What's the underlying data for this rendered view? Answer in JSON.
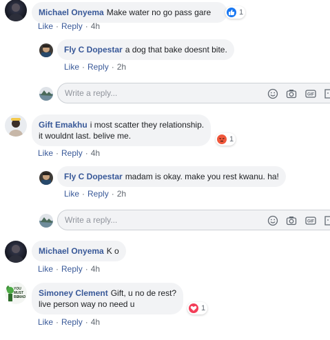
{
  "comments": [
    {
      "author": "Michael Onyema",
      "text": [
        "Make water no go pass gare"
      ],
      "reaction": {
        "type": "like",
        "count": "1"
      },
      "actions": {
        "like": "Like",
        "reply": "Reply",
        "time": "4h"
      }
    },
    {
      "author": "Fly C Dopestar",
      "text": [
        "a dog that bake doesnt bite."
      ],
      "actions": {
        "like": "Like",
        "reply": "Reply",
        "time": "2h"
      }
    },
    {
      "author": "Gift Emakhu",
      "text": [
        "i most scatter they relationship.",
        "it wouldnt last. belive me."
      ],
      "reaction": {
        "type": "angry",
        "count": "1"
      },
      "actions": {
        "like": "Like",
        "reply": "Reply",
        "time": "4h"
      }
    },
    {
      "author": "Fly C Dopestar",
      "text": [
        "madam is okay. make you rest kwanu. ha!"
      ],
      "actions": {
        "like": "Like",
        "reply": "Reply",
        "time": "2h"
      }
    },
    {
      "author": "Michael Onyema",
      "text": [
        "K o"
      ],
      "actions": {
        "like": "Like",
        "reply": "Reply",
        "time": "4h"
      }
    },
    {
      "author": "Simoney Clement",
      "text": [
        "Gift, u no de rest?",
        "live person way no need u"
      ],
      "reaction": {
        "type": "love",
        "count": "1"
      },
      "actions": {
        "like": "Like",
        "reply": "Reply",
        "time": "4h"
      }
    }
  ],
  "reply_box": {
    "placeholder": "Write a reply...",
    "tools": [
      "emoji-icon",
      "camera-icon",
      "gif-icon",
      "sticker-icon"
    ]
  },
  "avatar_badge_text": [
    "YOU",
    "MUST",
    "BE",
    "MAD"
  ],
  "colors": {
    "link": "#385898",
    "like": "#1877f2",
    "angry": "#f0573b",
    "love": "#f33e58",
    "bubble": "#f2f3f5"
  }
}
